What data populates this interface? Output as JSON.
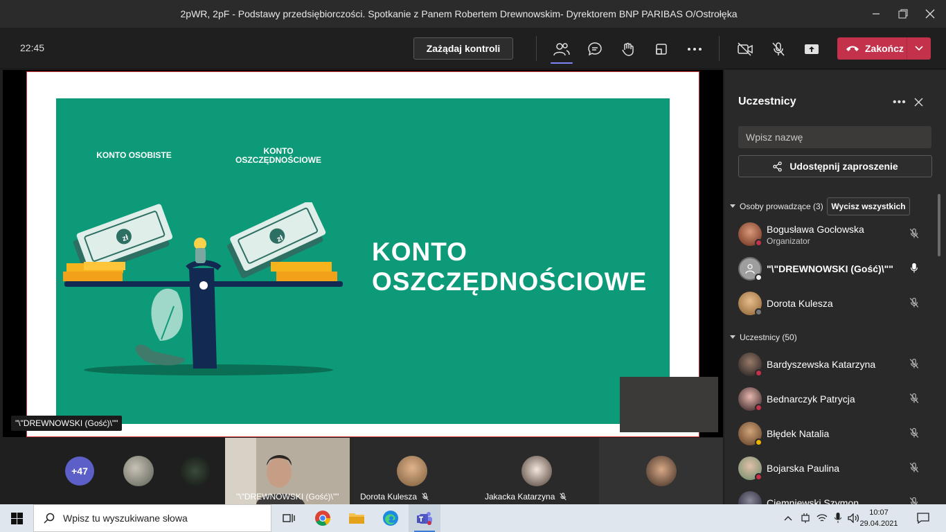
{
  "window": {
    "title": "2pWR, 2pF - Podstawy przedsiębiorczości. Spotkanie z Panem Robertem Drewnowskim- Dyrektorem BNP PARIBAS O/Ostrołęka"
  },
  "meeting_bar": {
    "elapsed_time": "22:45",
    "request_control_label": "Zażądaj kontroli",
    "end_call_label": "Zakończ"
  },
  "slide": {
    "label_left": "KONTO OSOBISTE",
    "label_right": "KONTO OSZCZĘDNOŚCIOWE",
    "title": "KONTO OSZCZĘDNOŚCIOWE",
    "currency_symbol": "zł"
  },
  "stage": {
    "presenter_name": "\"\\\"DREWNOWSKI (Gość)\\\"\""
  },
  "strip": {
    "more_count": "+47",
    "tiles": [
      {
        "name": "\"\\\"DREWNOWSKI (Gość)\\\"\""
      },
      {
        "name": "Dorota Kulesza"
      },
      {
        "name": "Jakacka Katarzyna"
      }
    ]
  },
  "panel": {
    "title": "Uczestnicy",
    "search_placeholder": "Wpisz nazwę",
    "share_invite_label": "Udostępnij zaproszenie",
    "presenters_section": "Osoby prowadzące (3)",
    "lower_all_label": "Wycisz wszystkich",
    "attendees_section": "Uczestnicy (50)",
    "presenters": [
      {
        "name": "Bogusława Gocłowska",
        "role": "Organizator"
      },
      {
        "name": "\"\\\"DREWNOWSKI (Gość)\\\"\""
      },
      {
        "name": "Dorota Kulesza"
      }
    ],
    "attendees": [
      {
        "name": "Bardyszewska Katarzyna"
      },
      {
        "name": "Bednarczyk Patrycja"
      },
      {
        "name": "Błędek Natalia"
      },
      {
        "name": "Bojarska Paulina"
      },
      {
        "name": "Ciemniewski Szymon"
      }
    ]
  },
  "taskbar": {
    "search_placeholder": "Wpisz tu wyszukiwane słowa",
    "time": "10:07",
    "date": "29.04.2021"
  },
  "colors": {
    "accent": "#5b5fc7",
    "end_call": "#c4314b",
    "slide_bg": "#0d9a78"
  }
}
